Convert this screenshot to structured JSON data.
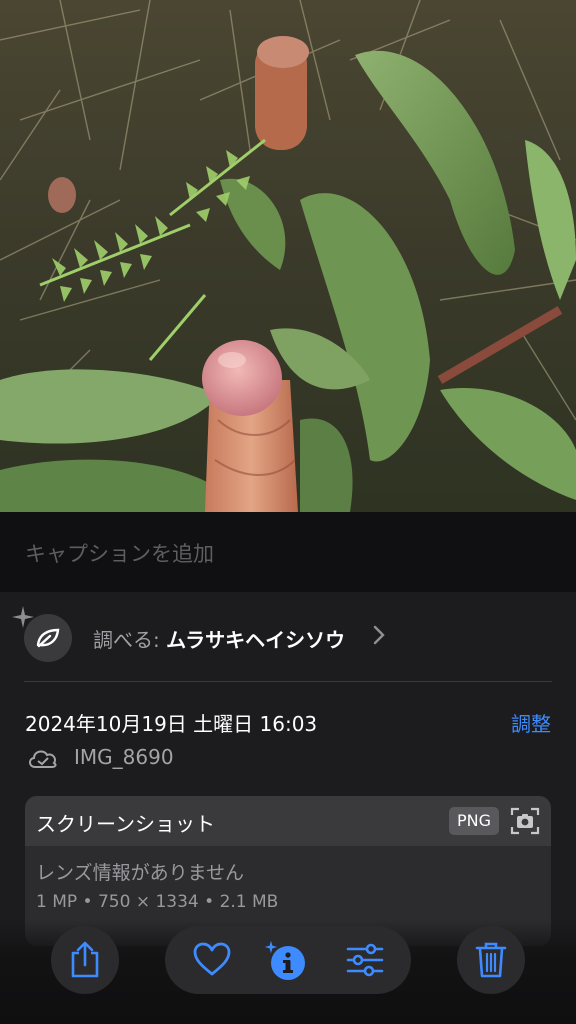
{
  "caption": {
    "placeholder": "キャプションを追加"
  },
  "lookup": {
    "prefix": "調べる:",
    "name": "ムラサキヘイシソウ"
  },
  "details": {
    "date": "2024年10月19日 土曜日 16:03",
    "adjust_label": "調整",
    "filename": "IMG_8690"
  },
  "card": {
    "title": "スクリーンショット",
    "format": "PNG",
    "lens": "レンズ情報がありません",
    "meta": "1 MP • 750 × 1334 • 2.1 MB"
  },
  "toolbar": {
    "share": "share-icon",
    "favorite": "heart-icon",
    "info": "info-sparkle-icon",
    "adjust": "sliders-icon",
    "delete": "trash-icon"
  },
  "colors": {
    "accent": "#3e8bff",
    "sheet_bg": "#1c1c1e",
    "card_bg": "#2c2c2e"
  }
}
